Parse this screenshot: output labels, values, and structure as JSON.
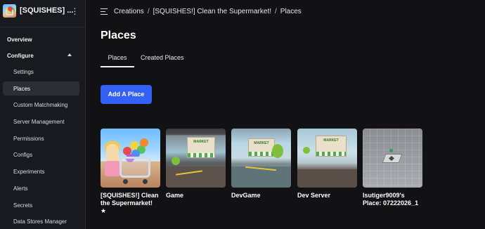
{
  "sidebar": {
    "experience_title": "[SQUISHES] ...",
    "kebab_icon": "kebab-menu-icon",
    "overview_label": "Overview",
    "configure_label": "Configure",
    "configure_chevron_icon": "chevron-up-icon",
    "items": [
      {
        "label": "Settings"
      },
      {
        "label": "Places",
        "active": true
      },
      {
        "label": "Custom Matchmaking"
      },
      {
        "label": "Server Management"
      },
      {
        "label": "Permissions"
      },
      {
        "label": "Configs"
      },
      {
        "label": "Experiments"
      },
      {
        "label": "Alerts"
      },
      {
        "label": "Secrets"
      },
      {
        "label": "Data Stores Manager"
      }
    ]
  },
  "breadcrumb": {
    "icon": "collapse-sidebar-icon",
    "items": [
      "Creations",
      "[SQUISHES!] Clean the Supermarket!",
      "Places"
    ],
    "separator": "/"
  },
  "page_title": "Places",
  "tabs": [
    {
      "label": "Places",
      "active": true
    },
    {
      "label": "Created Places",
      "active": false
    }
  ],
  "add_button_label": "Add A Place",
  "places": [
    {
      "name": "[SQUISHES!] Clean the Supermarket!",
      "star": "★"
    },
    {
      "name": "Game"
    },
    {
      "name": "DevGame"
    },
    {
      "name": "Dev Server"
    },
    {
      "name": "Isutiger9009's Place: 07222026_1"
    }
  ],
  "market_sign": "MARKET",
  "colors": {
    "background": "#121215",
    "sidebar": "#191a1f",
    "accent_button": "#3360f5",
    "active_nav": "#2d2e35"
  }
}
